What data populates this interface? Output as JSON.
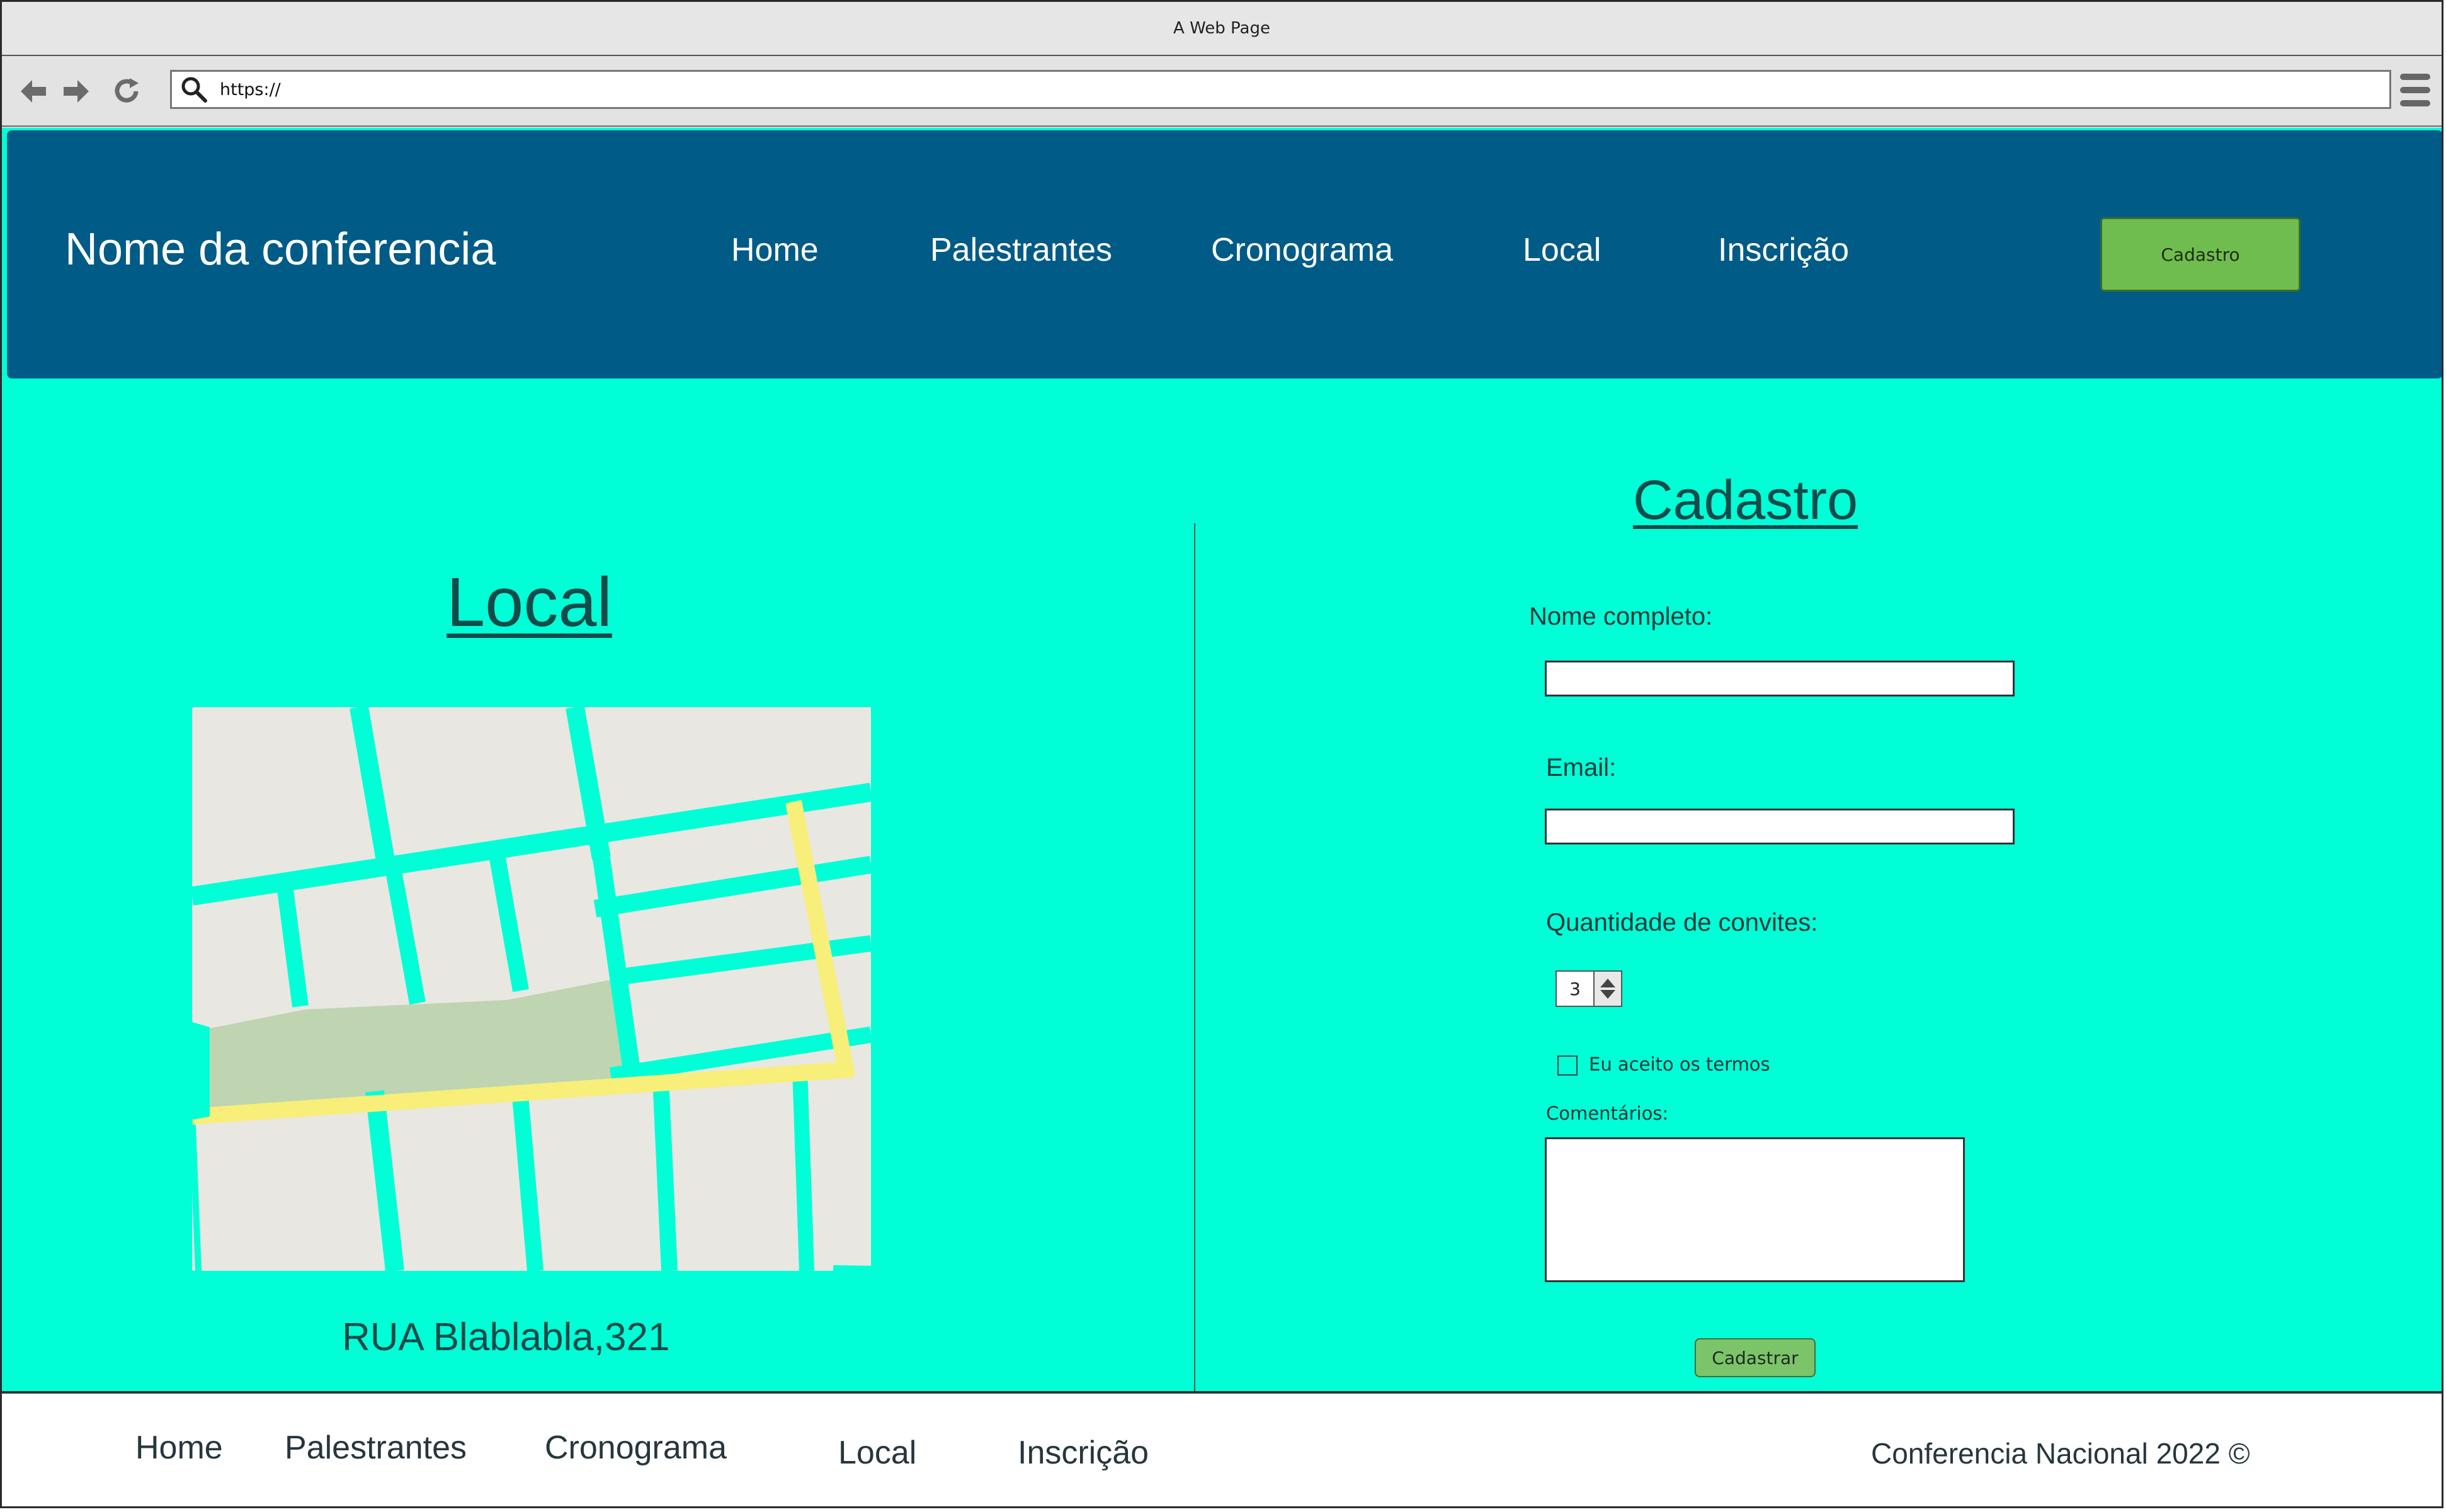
{
  "window": {
    "title": "A Web Page"
  },
  "browser": {
    "url": "https://"
  },
  "header": {
    "brand": "Nome da conferencia",
    "nav": [
      "Home",
      "Palestrantes",
      "Cronograma",
      "Local",
      "Inscrição"
    ],
    "cta_label": "Cadastro"
  },
  "local": {
    "heading": "Local",
    "address": "RUA Blablabla,321"
  },
  "form": {
    "heading": "Cadastro",
    "name_label": "Nome completo:",
    "email_label": "Email:",
    "qty_label": "Quantidade de convites:",
    "qty_value": "3",
    "terms_label": "Eu aceito os termos",
    "terms_checked": false,
    "comments_label": "Comentários:",
    "submit_label": "Cadastrar"
  },
  "footer": {
    "nav": [
      "Home",
      "Palestrantes",
      "Cronograma",
      "Local",
      "Inscrição"
    ],
    "copyright": "Conferencia Nacional 2022 ©"
  },
  "colors": {
    "page_bg": "#00ffd6",
    "header_bg": "#005b87",
    "cta_bg": "#6fbd4e",
    "map_block": "#e9e7e1",
    "map_park": "#bfd4b0",
    "map_highway": "#f8ee7a"
  }
}
